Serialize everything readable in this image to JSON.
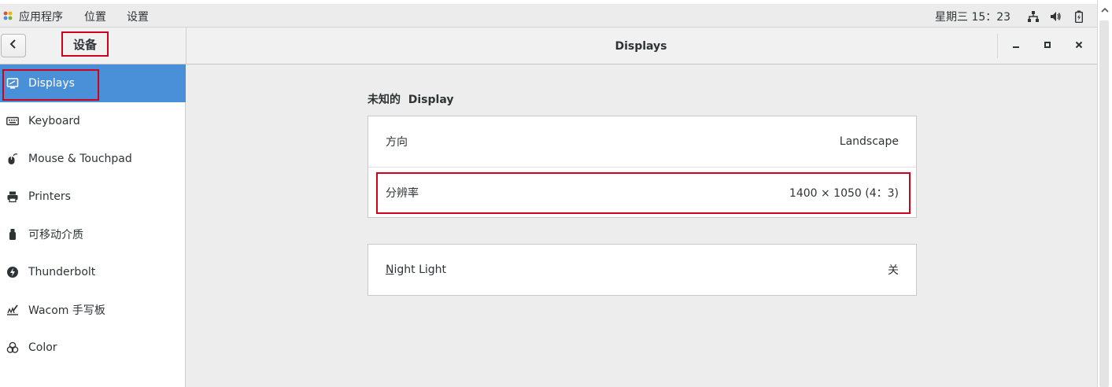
{
  "topbar": {
    "menu_apps": "应用程序",
    "menu_places": "位置",
    "menu_settings": "设置",
    "clock": "星期三 15：23",
    "icons": [
      "network-icon",
      "volume-icon",
      "battery-icon"
    ]
  },
  "header": {
    "section_label": "设备",
    "title": "Displays"
  },
  "sidebar": {
    "items": [
      {
        "label": "Displays",
        "icon": "display-icon"
      },
      {
        "label": "Keyboard",
        "icon": "keyboard-icon"
      },
      {
        "label": "Mouse & Touchpad",
        "icon": "mouse-icon"
      },
      {
        "label": "Printers",
        "icon": "printer-icon"
      },
      {
        "label": "可移动介质",
        "icon": "removable-media-icon"
      },
      {
        "label": "Thunderbolt",
        "icon": "thunderbolt-icon"
      },
      {
        "label": "Wacom 手写板",
        "icon": "tablet-icon"
      },
      {
        "label": "Color",
        "icon": "color-icon"
      }
    ],
    "active_index": 0
  },
  "main": {
    "display_title": "未知的  Display",
    "orientation_label": "方向",
    "orientation_value": "Landscape",
    "resolution_label": "分辨率",
    "resolution_value": "1400 × 1050 (4：3)",
    "night_light_mnemonic": "N",
    "night_light_rest": "ight Light",
    "night_light_value": "关"
  },
  "colors": {
    "accent": "#4a90d9",
    "highlight_box": "#d0021b",
    "main_bg": "#ededed"
  }
}
